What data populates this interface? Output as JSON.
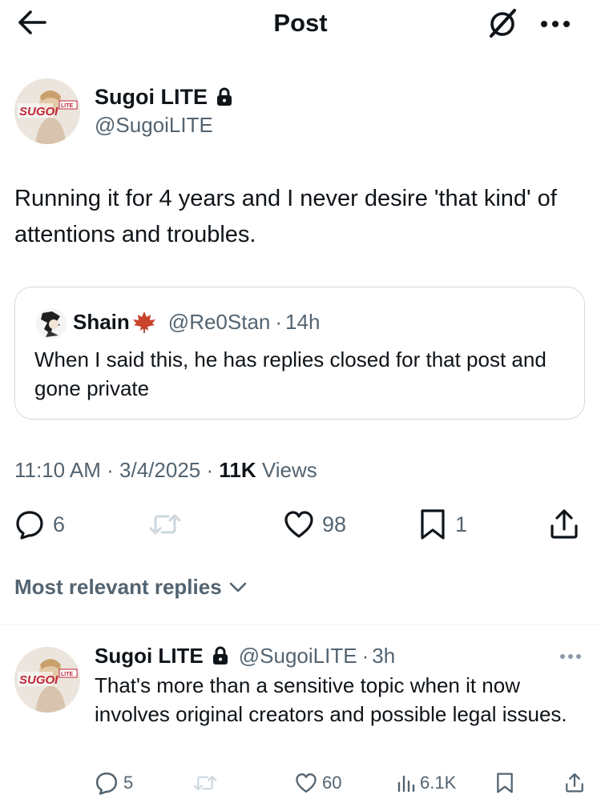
{
  "header": {
    "title": "Post"
  },
  "post": {
    "author": {
      "name": "Sugoi LITE",
      "handle": "@SugoiLITE",
      "avatar_text": "SUGOI",
      "avatar_badge": "LITE"
    },
    "text": "Running it for 4 years and I never desire 'that kind' of attentions and troubles.",
    "quote": {
      "name": "Shain",
      "handle": "@Re0Stan",
      "time": "14h",
      "text": "When I said this, he has replies closed for that post and gone private"
    },
    "timestamp": "11:10 AM · 3/4/2025 · ",
    "views_count": "11K",
    "views_label": " Views",
    "actions": {
      "replies": "6",
      "likes": "98",
      "bookmarks": "1"
    }
  },
  "replies_filter": {
    "label": "Most relevant replies"
  },
  "reply": {
    "author": {
      "name": "Sugoi LITE",
      "handle": "@SugoiLITE",
      "time": "3h"
    },
    "text": "That's more than a sensitive topic when it now involves original creators and possible legal issues.",
    "actions": {
      "replies": "5",
      "likes": "60",
      "views": "6.1K"
    }
  },
  "colors": {
    "text": "#0f1419",
    "secondary": "#536471",
    "border": "#cfd9de",
    "avatar_red": "#c0283a",
    "leaf": "#c8442a"
  },
  "icons": [
    "back-arrow-icon",
    "grok-icon",
    "more-icon",
    "lock-icon",
    "maple-leaf-icon",
    "reply-icon",
    "repost-icon",
    "like-icon",
    "bookmark-icon",
    "share-icon",
    "chevron-down-icon",
    "views-icon"
  ]
}
